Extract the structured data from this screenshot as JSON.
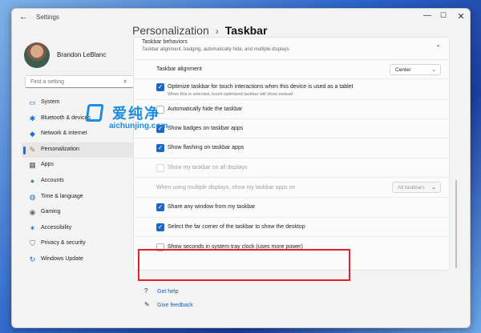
{
  "window": {
    "title": "Settings",
    "back_glyph": "←",
    "min_glyph": "—",
    "max_glyph": "☐",
    "close_glyph": "✕"
  },
  "user": {
    "name": "Brandon LeBlanc"
  },
  "search": {
    "placeholder": "Find a setting",
    "icon": "search-icon",
    "glyph": "⌕"
  },
  "nav": [
    {
      "label": "System",
      "icon": "monitor-icon",
      "glyph": "▭",
      "color": "#1a73c7"
    },
    {
      "label": "Bluetooth & devices",
      "icon": "bluetooth-icon",
      "glyph": "✱",
      "color": "#1a73c7"
    },
    {
      "label": "Network & internet",
      "icon": "wifi-icon",
      "glyph": "◆",
      "color": "#1a73c7"
    },
    {
      "label": "Personalization",
      "icon": "brush-icon",
      "glyph": "✎",
      "color": "#c26a2b"
    },
    {
      "label": "Apps",
      "icon": "apps-icon",
      "glyph": "▦",
      "color": "#5a5a5a"
    },
    {
      "label": "Accounts",
      "icon": "person-icon",
      "glyph": "●",
      "color": "#2b9d6d"
    },
    {
      "label": "Time & language",
      "icon": "globe-icon",
      "glyph": "◍",
      "color": "#1a73c7"
    },
    {
      "label": "Gaming",
      "icon": "gamepad-icon",
      "glyph": "◉",
      "color": "#6b6b6b"
    },
    {
      "label": "Accessibility",
      "icon": "accessibility-icon",
      "glyph": "✶",
      "color": "#1a73c7"
    },
    {
      "label": "Privacy & security",
      "icon": "shield-icon",
      "glyph": "⛉",
      "color": "#6b6b6b"
    },
    {
      "label": "Windows Update",
      "icon": "update-icon",
      "glyph": "↻",
      "color": "#1a73c7"
    }
  ],
  "breadcrumb": {
    "parent": "Personalization",
    "separator": "›",
    "current": "Taskbar"
  },
  "section": {
    "title": "Taskbar behaviors",
    "subtitle": "Taskbar alignment, badging, automatically hide, and multiple displays",
    "chevron": "⌃"
  },
  "settings": {
    "alignment": {
      "label": "Taskbar alignment",
      "value": "Center"
    },
    "touch": {
      "label": "Optimize taskbar for touch interactions when this device is used as a tablet",
      "sub": "When this is selected, touch-optimized taskbar will show instead",
      "checked": true
    },
    "autohide": {
      "label": "Automatically hide the taskbar",
      "checked": false
    },
    "badges": {
      "label": "Show badges on taskbar apps",
      "checked": true
    },
    "flashing": {
      "label": "Show flashing on taskbar apps",
      "checked": true
    },
    "all_displays": {
      "label": "Show my taskbar on all displays",
      "checked": false,
      "disabled": true
    },
    "multi_display": {
      "label": "When using multiple displays, show my taskbar apps on",
      "value": "All taskbars",
      "disabled": true
    },
    "share": {
      "label": "Share any window from my taskbar",
      "checked": true
    },
    "far_corner": {
      "label": "Select the far corner of the taskbar to show the desktop",
      "checked": true
    },
    "seconds": {
      "label": "Show seconds in system tray clock (uses more power)",
      "checked": false
    }
  },
  "links": {
    "help": "Get help",
    "feedback": "Give feedback"
  },
  "watermark": {
    "cn": "爱纯净",
    "url": "aichunjing.com"
  },
  "colors": {
    "accent": "#1a67c4",
    "highlight": "#e3212b"
  }
}
